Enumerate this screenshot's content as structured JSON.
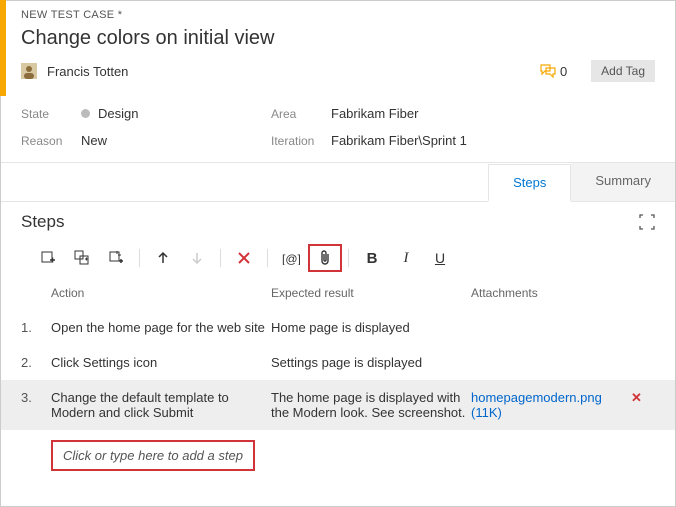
{
  "header": {
    "tab_label": "NEW TEST CASE *",
    "title": "Change colors on initial view",
    "assigned_to": "Francis Totten",
    "discussion_count": "0",
    "add_tag_label": "Add Tag"
  },
  "fields": {
    "state_label": "State",
    "state_value": "Design",
    "reason_label": "Reason",
    "reason_value": "New",
    "area_label": "Area",
    "area_value": "Fabrikam Fiber",
    "iteration_label": "Iteration",
    "iteration_value": "Fabrikam Fiber\\Sprint 1"
  },
  "tabs": {
    "steps": "Steps",
    "summary": "Summary"
  },
  "steps_section": {
    "title": "Steps",
    "col_action": "Action",
    "col_expected": "Expected result",
    "col_attachments": "Attachments",
    "add_step_placeholder": "Click or type here to add a step"
  },
  "steps": [
    {
      "num": "1.",
      "action": "Open the home page for the web site",
      "expected": "Home page is displayed",
      "attachment": ""
    },
    {
      "num": "2.",
      "action": "Click Settings icon",
      "expected": "Settings page is displayed",
      "attachment": ""
    },
    {
      "num": "3.",
      "action": "Change the default template to Modern and click Submit",
      "expected": "The home page is displayed with the Modern look. See screenshot.",
      "attachment": "homepagemodern.png (11K)"
    }
  ]
}
